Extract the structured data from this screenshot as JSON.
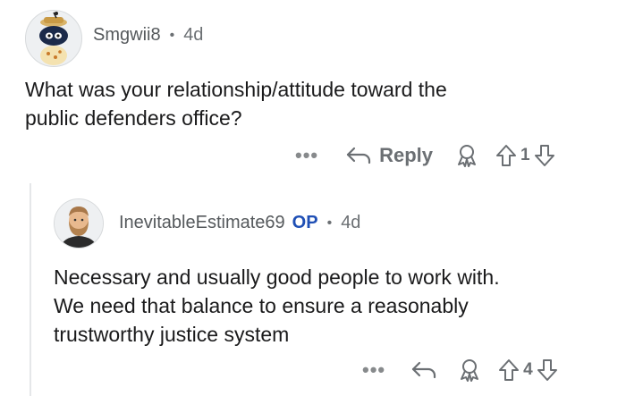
{
  "comments": [
    {
      "username": "Smgwii8",
      "separator": "•",
      "age": "4d",
      "text_lines": [
        "What was your relationship/attitude toward the",
        "public defenders office?"
      ],
      "actions": {
        "more": "•••",
        "reply_label": "Reply",
        "vote_count": "1"
      },
      "avatar_icon": "snoo-avatar-icon"
    },
    {
      "username": "InevitableEstimate69",
      "op_badge": "OP",
      "separator": "•",
      "age": "4d",
      "text_lines": [
        "Necessary and usually good people to work with.",
        "We need that balance to ensure a reasonably",
        "trustworthy justice system"
      ],
      "actions": {
        "more": "•••",
        "vote_count": "4"
      },
      "avatar_icon": "bearded-man-avatar-icon"
    }
  ],
  "colors": {
    "text": "#1a1a1b",
    "meta": "#6b6f73",
    "op": "#1f4fb5",
    "thread_line": "#e5e7e9"
  }
}
